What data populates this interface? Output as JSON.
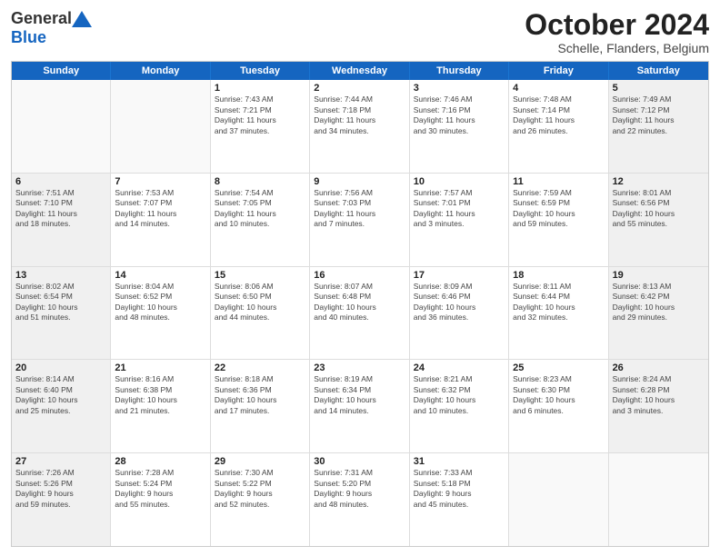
{
  "logo": {
    "line1": "General",
    "line2": "Blue"
  },
  "title": "October 2024",
  "subtitle": "Schelle, Flanders, Belgium",
  "weekdays": [
    "Sunday",
    "Monday",
    "Tuesday",
    "Wednesday",
    "Thursday",
    "Friday",
    "Saturday"
  ],
  "weeks": [
    [
      {
        "day": "",
        "info": "",
        "empty": true
      },
      {
        "day": "",
        "info": "",
        "empty": true
      },
      {
        "day": "1",
        "info": "Sunrise: 7:43 AM\nSunset: 7:21 PM\nDaylight: 11 hours\nand 37 minutes."
      },
      {
        "day": "2",
        "info": "Sunrise: 7:44 AM\nSunset: 7:18 PM\nDaylight: 11 hours\nand 34 minutes."
      },
      {
        "day": "3",
        "info": "Sunrise: 7:46 AM\nSunset: 7:16 PM\nDaylight: 11 hours\nand 30 minutes."
      },
      {
        "day": "4",
        "info": "Sunrise: 7:48 AM\nSunset: 7:14 PM\nDaylight: 11 hours\nand 26 minutes."
      },
      {
        "day": "5",
        "info": "Sunrise: 7:49 AM\nSunset: 7:12 PM\nDaylight: 11 hours\nand 22 minutes.",
        "shaded": true
      }
    ],
    [
      {
        "day": "6",
        "info": "Sunrise: 7:51 AM\nSunset: 7:10 PM\nDaylight: 11 hours\nand 18 minutes.",
        "shaded": true
      },
      {
        "day": "7",
        "info": "Sunrise: 7:53 AM\nSunset: 7:07 PM\nDaylight: 11 hours\nand 14 minutes."
      },
      {
        "day": "8",
        "info": "Sunrise: 7:54 AM\nSunset: 7:05 PM\nDaylight: 11 hours\nand 10 minutes."
      },
      {
        "day": "9",
        "info": "Sunrise: 7:56 AM\nSunset: 7:03 PM\nDaylight: 11 hours\nand 7 minutes."
      },
      {
        "day": "10",
        "info": "Sunrise: 7:57 AM\nSunset: 7:01 PM\nDaylight: 11 hours\nand 3 minutes."
      },
      {
        "day": "11",
        "info": "Sunrise: 7:59 AM\nSunset: 6:59 PM\nDaylight: 10 hours\nand 59 minutes."
      },
      {
        "day": "12",
        "info": "Sunrise: 8:01 AM\nSunset: 6:56 PM\nDaylight: 10 hours\nand 55 minutes.",
        "shaded": true
      }
    ],
    [
      {
        "day": "13",
        "info": "Sunrise: 8:02 AM\nSunset: 6:54 PM\nDaylight: 10 hours\nand 51 minutes.",
        "shaded": true
      },
      {
        "day": "14",
        "info": "Sunrise: 8:04 AM\nSunset: 6:52 PM\nDaylight: 10 hours\nand 48 minutes."
      },
      {
        "day": "15",
        "info": "Sunrise: 8:06 AM\nSunset: 6:50 PM\nDaylight: 10 hours\nand 44 minutes."
      },
      {
        "day": "16",
        "info": "Sunrise: 8:07 AM\nSunset: 6:48 PM\nDaylight: 10 hours\nand 40 minutes."
      },
      {
        "day": "17",
        "info": "Sunrise: 8:09 AM\nSunset: 6:46 PM\nDaylight: 10 hours\nand 36 minutes."
      },
      {
        "day": "18",
        "info": "Sunrise: 8:11 AM\nSunset: 6:44 PM\nDaylight: 10 hours\nand 32 minutes."
      },
      {
        "day": "19",
        "info": "Sunrise: 8:13 AM\nSunset: 6:42 PM\nDaylight: 10 hours\nand 29 minutes.",
        "shaded": true
      }
    ],
    [
      {
        "day": "20",
        "info": "Sunrise: 8:14 AM\nSunset: 6:40 PM\nDaylight: 10 hours\nand 25 minutes.",
        "shaded": true
      },
      {
        "day": "21",
        "info": "Sunrise: 8:16 AM\nSunset: 6:38 PM\nDaylight: 10 hours\nand 21 minutes."
      },
      {
        "day": "22",
        "info": "Sunrise: 8:18 AM\nSunset: 6:36 PM\nDaylight: 10 hours\nand 17 minutes."
      },
      {
        "day": "23",
        "info": "Sunrise: 8:19 AM\nSunset: 6:34 PM\nDaylight: 10 hours\nand 14 minutes."
      },
      {
        "day": "24",
        "info": "Sunrise: 8:21 AM\nSunset: 6:32 PM\nDaylight: 10 hours\nand 10 minutes."
      },
      {
        "day": "25",
        "info": "Sunrise: 8:23 AM\nSunset: 6:30 PM\nDaylight: 10 hours\nand 6 minutes."
      },
      {
        "day": "26",
        "info": "Sunrise: 8:24 AM\nSunset: 6:28 PM\nDaylight: 10 hours\nand 3 minutes.",
        "shaded": true
      }
    ],
    [
      {
        "day": "27",
        "info": "Sunrise: 7:26 AM\nSunset: 5:26 PM\nDaylight: 9 hours\nand 59 minutes.",
        "shaded": true
      },
      {
        "day": "28",
        "info": "Sunrise: 7:28 AM\nSunset: 5:24 PM\nDaylight: 9 hours\nand 55 minutes."
      },
      {
        "day": "29",
        "info": "Sunrise: 7:30 AM\nSunset: 5:22 PM\nDaylight: 9 hours\nand 52 minutes."
      },
      {
        "day": "30",
        "info": "Sunrise: 7:31 AM\nSunset: 5:20 PM\nDaylight: 9 hours\nand 48 minutes."
      },
      {
        "day": "31",
        "info": "Sunrise: 7:33 AM\nSunset: 5:18 PM\nDaylight: 9 hours\nand 45 minutes."
      },
      {
        "day": "",
        "info": "",
        "empty": true
      },
      {
        "day": "",
        "info": "",
        "empty": true
      }
    ]
  ]
}
